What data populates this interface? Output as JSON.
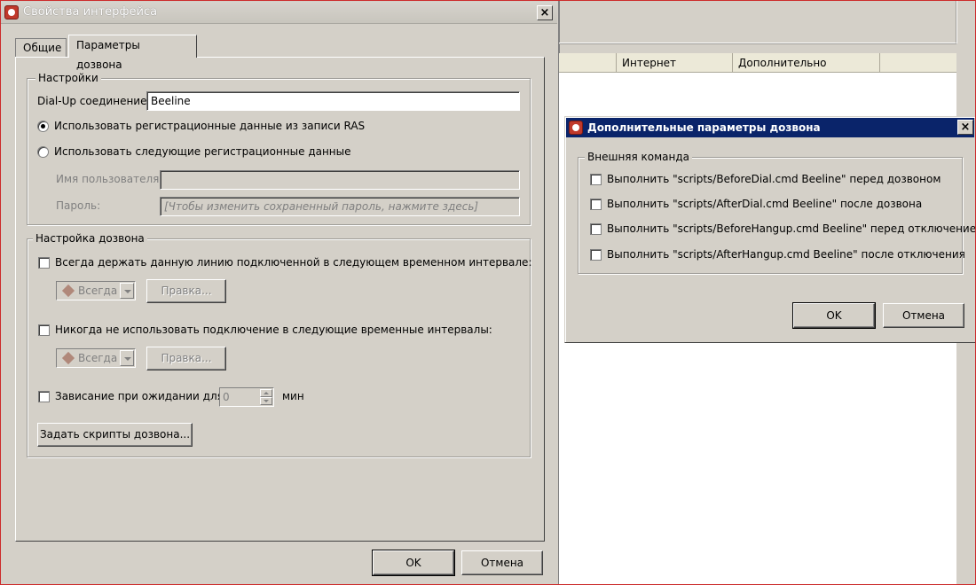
{
  "main_dialog": {
    "title": "Свойства интерфейса",
    "close_glyph": "×",
    "tabs": [
      {
        "label": "Общие",
        "active": false
      },
      {
        "label": "Параметры дозвона",
        "active": true
      }
    ],
    "settings_group": {
      "label": "Настройки",
      "dialup_label": "Dial-Up соединение:",
      "dialup_value": "Beeline",
      "radio_ras": {
        "label": "Использовать регистрационные данные из записи RAS",
        "checked": true
      },
      "radio_custom": {
        "label": "Использовать следующие регистрационные данные",
        "checked": false
      },
      "username_label": "Имя пользователя:",
      "username_value": "",
      "password_label": "Пароль:",
      "password_placeholder": "[Чтобы изменить сохраненный пароль, нажмите здесь]"
    },
    "dial_group": {
      "label": "Настройка дозвона",
      "keep_connected": {
        "label": "Всегда держать данную линию подключенной в следующем временном интервале:",
        "checked": false
      },
      "keep_combo_value": "Всегда",
      "keep_edit_button": "Правка...",
      "never_use": {
        "label": "Никогда не использовать подключение в следующие временные интервалы:",
        "checked": false
      },
      "never_combo_value": "Всегда",
      "never_edit_button": "Правка...",
      "hangup_idle": {
        "label": "Зависание при ожидании для",
        "checked": false
      },
      "hangup_value": "0",
      "hangup_unit": "мин",
      "scripts_button": "Задать скрипты дозвона..."
    },
    "ok_button": "OK",
    "cancel_button": "Отмена"
  },
  "background_window": {
    "columns": [
      "",
      "Интернет",
      "Дополнительно"
    ]
  },
  "advanced_dialog": {
    "title": "Дополнительные параметры дозвона",
    "close_glyph": "×",
    "group_label": "Внешняя команда",
    "commands": [
      {
        "label": "Выполнить \"scripts/BeforeDial.cmd Beeline\" перед дозвоном",
        "checked": false
      },
      {
        "label": "Выполнить \"scripts/AfterDial.cmd Beeline\" после дозвона",
        "checked": false
      },
      {
        "label": "Выполнить \"scripts/BeforeHangup.cmd Beeline\" перед отключением",
        "checked": false
      },
      {
        "label": "Выполнить \"scripts/AfterHangup.cmd Beeline\" после отключения",
        "checked": false
      }
    ],
    "ok_button": "OK",
    "cancel_button": "Отмена"
  },
  "colors": {
    "window_face": "#d4d0c8",
    "active_title": "#0a246a",
    "frame_red": "#cc2b2b"
  }
}
